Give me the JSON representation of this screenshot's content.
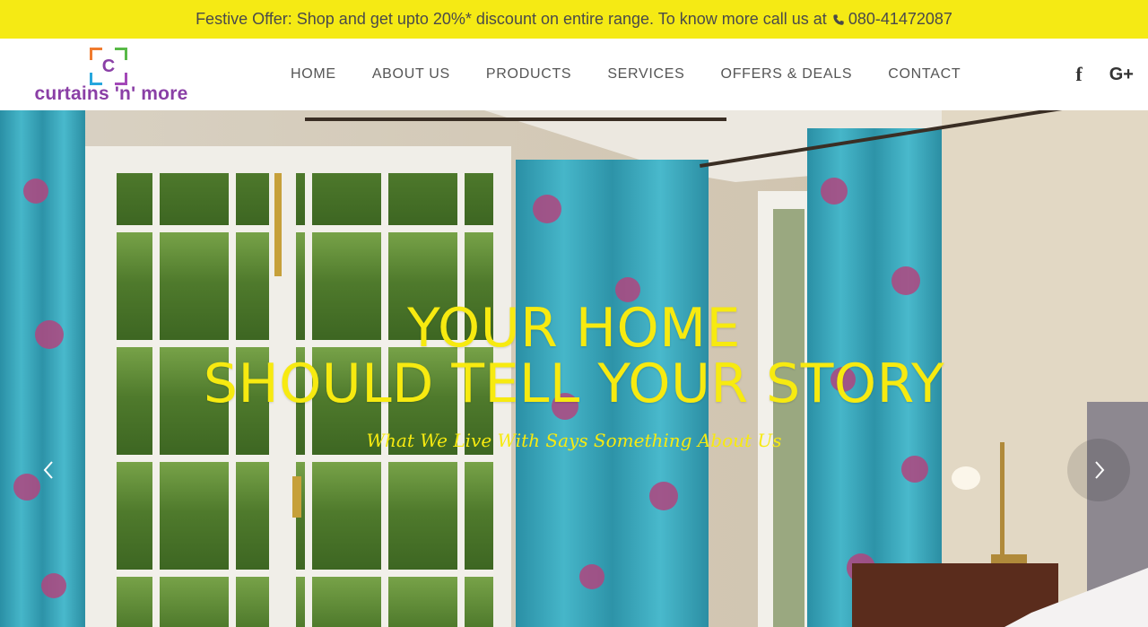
{
  "topbar": {
    "offer_text": "Festive Offer: Shop and get upto 20%* discount on entire range. To know more call us at",
    "phone_icon": "phone-icon",
    "phone": "080-41472087",
    "bg_color": "#f5ea14"
  },
  "logo": {
    "letter": "C",
    "name": "curtains 'n' more",
    "brand_color": "#8a3fa6"
  },
  "nav": {
    "items": [
      {
        "label": "HOME"
      },
      {
        "label": "ABOUT US"
      },
      {
        "label": "PRODUCTS"
      },
      {
        "label": "SERVICES"
      },
      {
        "label": "OFFERS & DEALS"
      },
      {
        "label": "CONTACT"
      }
    ]
  },
  "social": {
    "facebook_glyph": "f",
    "google_plus_glyph": "G+",
    "facebook_icon": "facebook-icon",
    "google_plus_icon": "google-plus-icon"
  },
  "hero": {
    "title_line1": "YOUR HOME",
    "title_line2": "SHOULD TELL YOUR STORY",
    "subtitle": "What We Live With Says Something About Us",
    "text_color": "#f7ea10",
    "prev_icon": "chevron-left-icon",
    "next_icon": "chevron-right-icon"
  }
}
